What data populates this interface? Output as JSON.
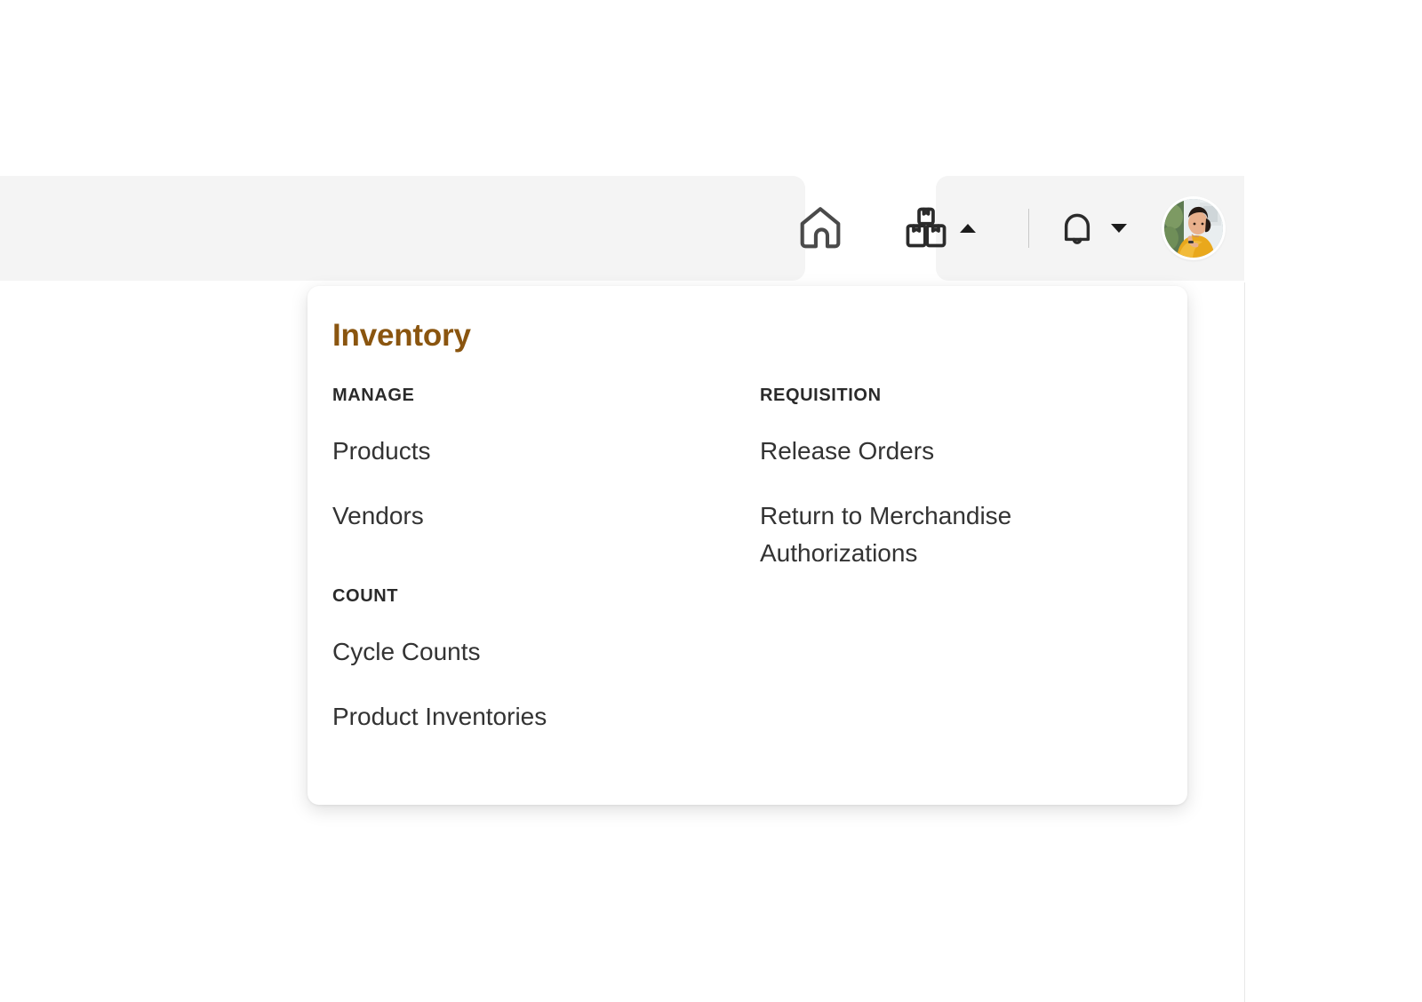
{
  "appbar": {
    "home_button_label": "Home",
    "home_icon": "home-icon",
    "inventory_tab_label": "Inventory",
    "inventory_icon": "boxes-icon",
    "inventory_caret": "caret-up-icon",
    "notifications_label": "Notifications",
    "notifications_icon": "bell-icon",
    "notifications_caret": "caret-down-icon",
    "avatar_label": "User profile",
    "avatar_icon": "avatar-photo"
  },
  "dropdown": {
    "title": "Inventory",
    "title_color": "#8a550f",
    "columns": [
      {
        "sections": [
          {
            "heading": "MANAGE",
            "links": [
              {
                "label": "Products"
              },
              {
                "label": "Vendors"
              }
            ]
          },
          {
            "heading": "COUNT",
            "links": [
              {
                "label": "Cycle Counts"
              },
              {
                "label": "Product Inventories"
              }
            ]
          }
        ]
      },
      {
        "sections": [
          {
            "heading": "REQUISITION",
            "links": [
              {
                "label": "Release Orders"
              },
              {
                "label": "Return to Merchandise Authorizations"
              }
            ]
          }
        ]
      }
    ]
  }
}
